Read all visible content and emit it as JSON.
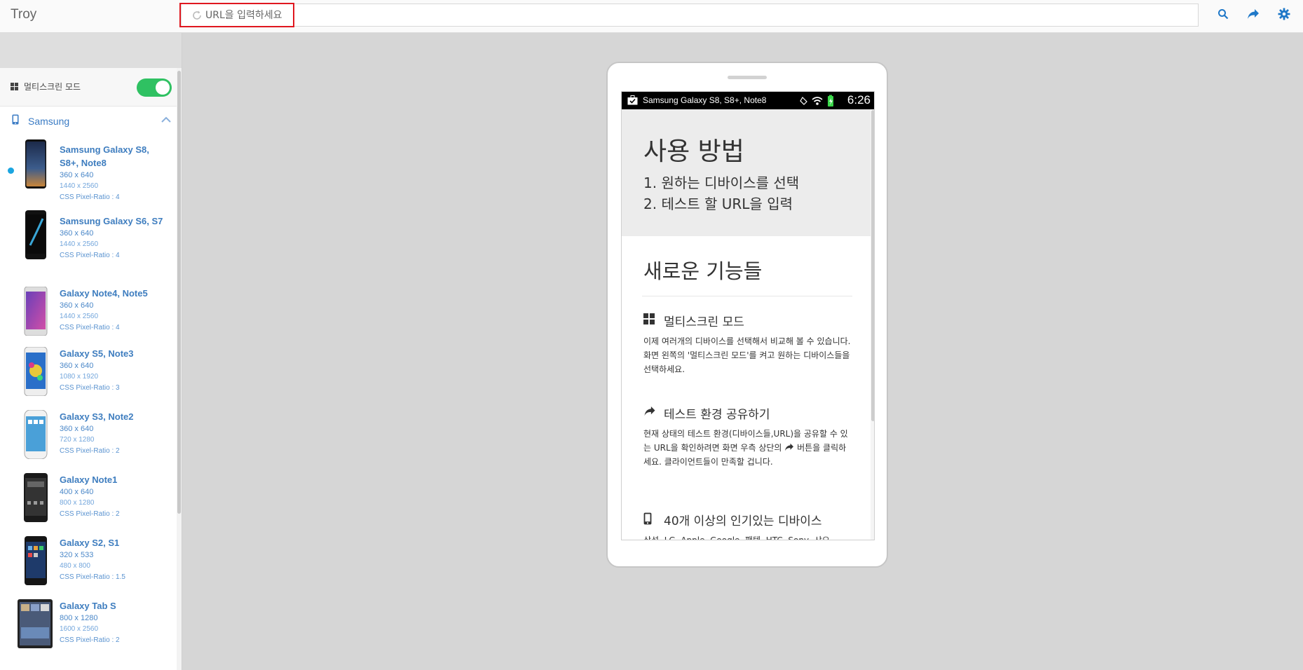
{
  "app": {
    "title": "Troy"
  },
  "urlbar": {
    "placeholder": "URL을 입력하세요"
  },
  "sidebar": {
    "multiscreen_label": "멀티스크린 모드",
    "multiscreen_on": true,
    "group_label": "Samsung",
    "devices": [
      {
        "name": "Samsung Galaxy S8, S8+, Note8",
        "css": "360 x 640",
        "physical": "1440 x 2560",
        "ratio": "CSS Pixel-Ratio : 4",
        "selected": true
      },
      {
        "name": "Samsung Galaxy S6, S7",
        "css": "360 x 640",
        "physical": "1440 x 2560",
        "ratio": "CSS Pixel-Ratio : 4",
        "selected": false
      },
      {
        "name": "Galaxy Note4, Note5",
        "css": "360 x 640",
        "physical": "1440 x 2560",
        "ratio": "CSS Pixel-Ratio : 4",
        "selected": false
      },
      {
        "name": "Galaxy S5, Note3",
        "css": "360 x 640",
        "physical": "1080 x 1920",
        "ratio": "CSS Pixel-Ratio : 3",
        "selected": false
      },
      {
        "name": "Galaxy S3, Note2",
        "css": "360 x 640",
        "physical": "720 x 1280",
        "ratio": "CSS Pixel-Ratio : 2",
        "selected": false
      },
      {
        "name": "Galaxy Note1",
        "css": "400 x 640",
        "physical": "800 x 1280",
        "ratio": "CSS Pixel-Ratio : 2",
        "selected": false
      },
      {
        "name": "Galaxy S2, S1",
        "css": "320 x 533",
        "physical": "480 x 800",
        "ratio": "CSS Pixel-Ratio : 1.5",
        "selected": false
      },
      {
        "name": "Galaxy Tab S",
        "css": "800 x 1280",
        "physical": "1600 x 2560",
        "ratio": "CSS Pixel-Ratio : 2",
        "selected": false
      }
    ]
  },
  "phone": {
    "status_title": "Samsung Galaxy S8, S8+, Note8",
    "status_time": "6:26",
    "hero_title": "사용 방법",
    "step1": "1. 원하는 디바이스를 선택",
    "step2": "2. 테스트 할 URL을 입력",
    "new_title": "새로운 기능들",
    "feature1_title": "멀티스크린 모드",
    "feature1_body": "이제 여러개의 디바이스를 선택해서 비교해 볼 수 있습니다. 화면 왼쪽의 '멀티스크린 모드'를 켜고 원하는 디바이스들을 선택하세요.",
    "feature2_title": "테스트 환경 공유하기",
    "feature2_body_a": "현재 상태의 테스트 환경(디바이스들,URL)을 공유할 수 있는 URL을 확인하려면 화면 우측 상단의",
    "feature2_body_b": "버튼을 클릭하세요. 클라이언트들이 만족할 겁니다.",
    "feature3_title": "40개 이상의 인기있는 디바이스",
    "feature3_body": "삼성, LG, Apple, Google, 팬텍, HTC, Sony, 샤오"
  },
  "colors": {
    "accent": "#3e7dbf",
    "toggle_on": "#2fc162",
    "highlight": "#e0171f",
    "selected_dot": "#1ba5e0"
  },
  "icons": [
    "reload-icon",
    "search-icon",
    "share-icon",
    "settings-icon",
    "grid-icon",
    "phone-icon",
    "chevron-up-icon"
  ]
}
